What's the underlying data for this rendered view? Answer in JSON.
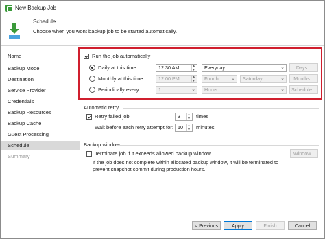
{
  "window": {
    "title": "New Backup Job"
  },
  "header": {
    "title": "Schedule",
    "subtitle": "Choose when you wont backup job to be started automatically."
  },
  "sidebar": {
    "items": [
      {
        "label": "Name",
        "state": "normal"
      },
      {
        "label": "Backup Mode",
        "state": "normal"
      },
      {
        "label": "Destination",
        "state": "normal"
      },
      {
        "label": "Service Provider",
        "state": "normal"
      },
      {
        "label": "Credentials",
        "state": "normal"
      },
      {
        "label": "Backup Resources",
        "state": "normal"
      },
      {
        "label": "Backup Cache",
        "state": "normal"
      },
      {
        "label": "Guest Processing",
        "state": "normal"
      },
      {
        "label": "Schedule",
        "state": "active"
      },
      {
        "label": "Summary",
        "state": "disabled"
      }
    ]
  },
  "schedule": {
    "run_auto_label": "Run the job automatically",
    "run_auto_checked": true,
    "daily": {
      "label": "Daily at this time:",
      "time": "12:30 AM",
      "frequency": "Everyday",
      "button": "Days..."
    },
    "monthly": {
      "label": "Monthly at this time:",
      "time": "12:00 PM",
      "week": "Fourth",
      "day": "Saturday",
      "button": "Months..."
    },
    "periodic": {
      "label": "Periodically every:",
      "value": "1",
      "unit": "Hours",
      "button": "Schedule..."
    },
    "selected": "daily"
  },
  "retry": {
    "title": "Automatic retry",
    "retry_label": "Retry failed job",
    "retry_checked": true,
    "retry_count": "3",
    "times_label": "times",
    "wait_label": "Wait before each retry attempt for:",
    "wait_value": "10",
    "minutes_label": "minutes"
  },
  "backup_window": {
    "title": "Backup window",
    "terminate_label": "Terminate job if it exceeds allowed backup window",
    "terminate_checked": false,
    "button": "Window...",
    "note_line1": "If the job does not complete within allocated backup window, it will be terminated to",
    "note_line2": "prevent snapshot commit during production hours."
  },
  "footer": {
    "previous": "< Previous",
    "apply": "Apply",
    "finish": "Finish",
    "cancel": "Cancel"
  },
  "colors": {
    "highlight": "#d01f2e",
    "active_nav": "#d9d9d9",
    "app_icon": "#3a9a3a"
  }
}
